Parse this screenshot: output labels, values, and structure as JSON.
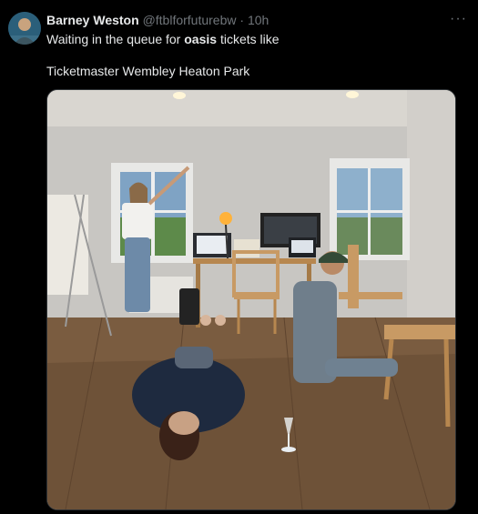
{
  "tweet": {
    "author_name": "Barney Weston",
    "handle": "@ftblforfuturebw",
    "separator": "·",
    "time": "10h",
    "text_prefix": "Waiting in the queue for ",
    "text_bold": "oasis",
    "text_suffix": " tickets like",
    "text_line2": "Ticketmaster Wembley Heaton Park",
    "more_icon": "more-horizontal-icon"
  },
  "colors": {
    "background": "#000000",
    "text": "#e7e9ea",
    "secondary_text": "#71767b"
  }
}
